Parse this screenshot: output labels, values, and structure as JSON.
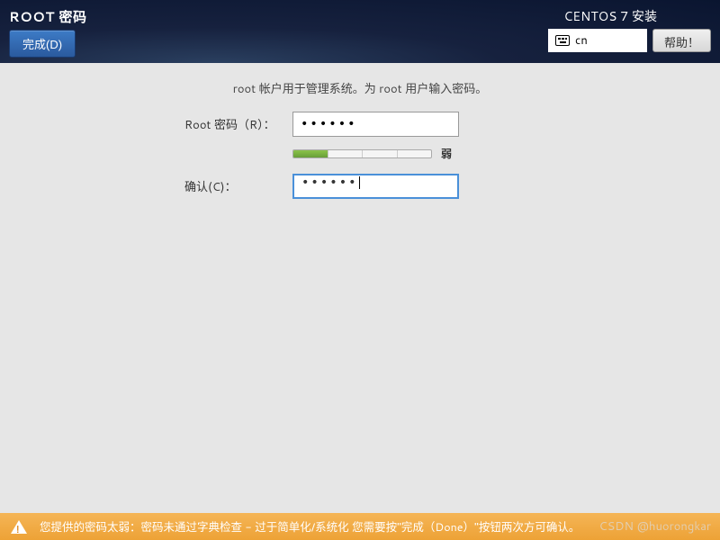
{
  "header": {
    "title": "ROOT 密码",
    "done_button": "完成(D)",
    "installer_title": "CENTOS 7 安装",
    "lang_code": "cn",
    "help_button": "帮助！"
  },
  "form": {
    "instruction": "root 帐户用于管理系统。为 root 用户输入密码。",
    "password_label": "Root 密码（R）：",
    "password_value": "••••••",
    "confirm_label": "确认(C)：",
    "confirm_value": "••••••",
    "strength_text": "弱"
  },
  "warning": {
    "message": "您提供的密码太弱：密码未通过字典检查 - 过于简单化/系统化 您需要按\"完成（Done）\"按钮两次方可确认。"
  },
  "watermark": "CSDN @huorongkar"
}
